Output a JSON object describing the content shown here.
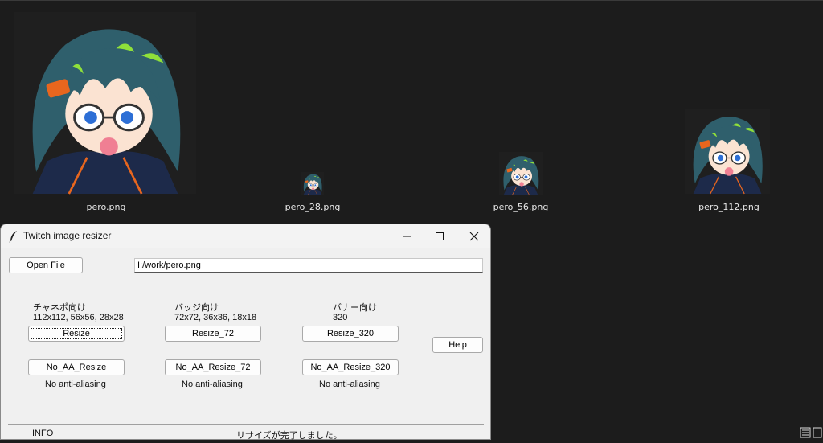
{
  "files": [
    {
      "name": "pero.png"
    },
    {
      "name": "pero_28.png"
    },
    {
      "name": "pero_56.png"
    },
    {
      "name": "pero_112.png"
    }
  ],
  "window": {
    "title": "Twitch image resizer",
    "open_file_label": "Open File",
    "path_value": "I:/work/pero.png",
    "groups": [
      {
        "heading": "チャネポ向け",
        "sizes": "112x112, 56x56, 28x28",
        "resize_label": "Resize",
        "no_aa_label": "No_AA_Resize",
        "note": "No anti-aliasing"
      },
      {
        "heading": "バッジ向け",
        "sizes": "72x72, 36x36, 18x18",
        "resize_label": "Resize_72",
        "no_aa_label": "No_AA_Resize_72",
        "note": "No anti-aliasing"
      },
      {
        "heading": "バナー向け",
        "sizes": "320",
        "resize_label": "Resize_320",
        "no_aa_label": "No_AA_Resize_320",
        "note": "No anti-aliasing"
      }
    ],
    "help_label": "Help",
    "status": {
      "level": "INFO",
      "message": "リサイズが完了しました。"
    }
  },
  "colors": {
    "desktop": "#1c1c1c",
    "window_bg": "#f0f0f0",
    "hair": "#2f5f6c",
    "hair_highlight": "#8fe03a",
    "clip": "#e8661e"
  },
  "icons": {
    "window_icon": "feather-icon",
    "minimize": "minimize-icon",
    "maximize": "maximize-icon",
    "close": "close-icon"
  }
}
